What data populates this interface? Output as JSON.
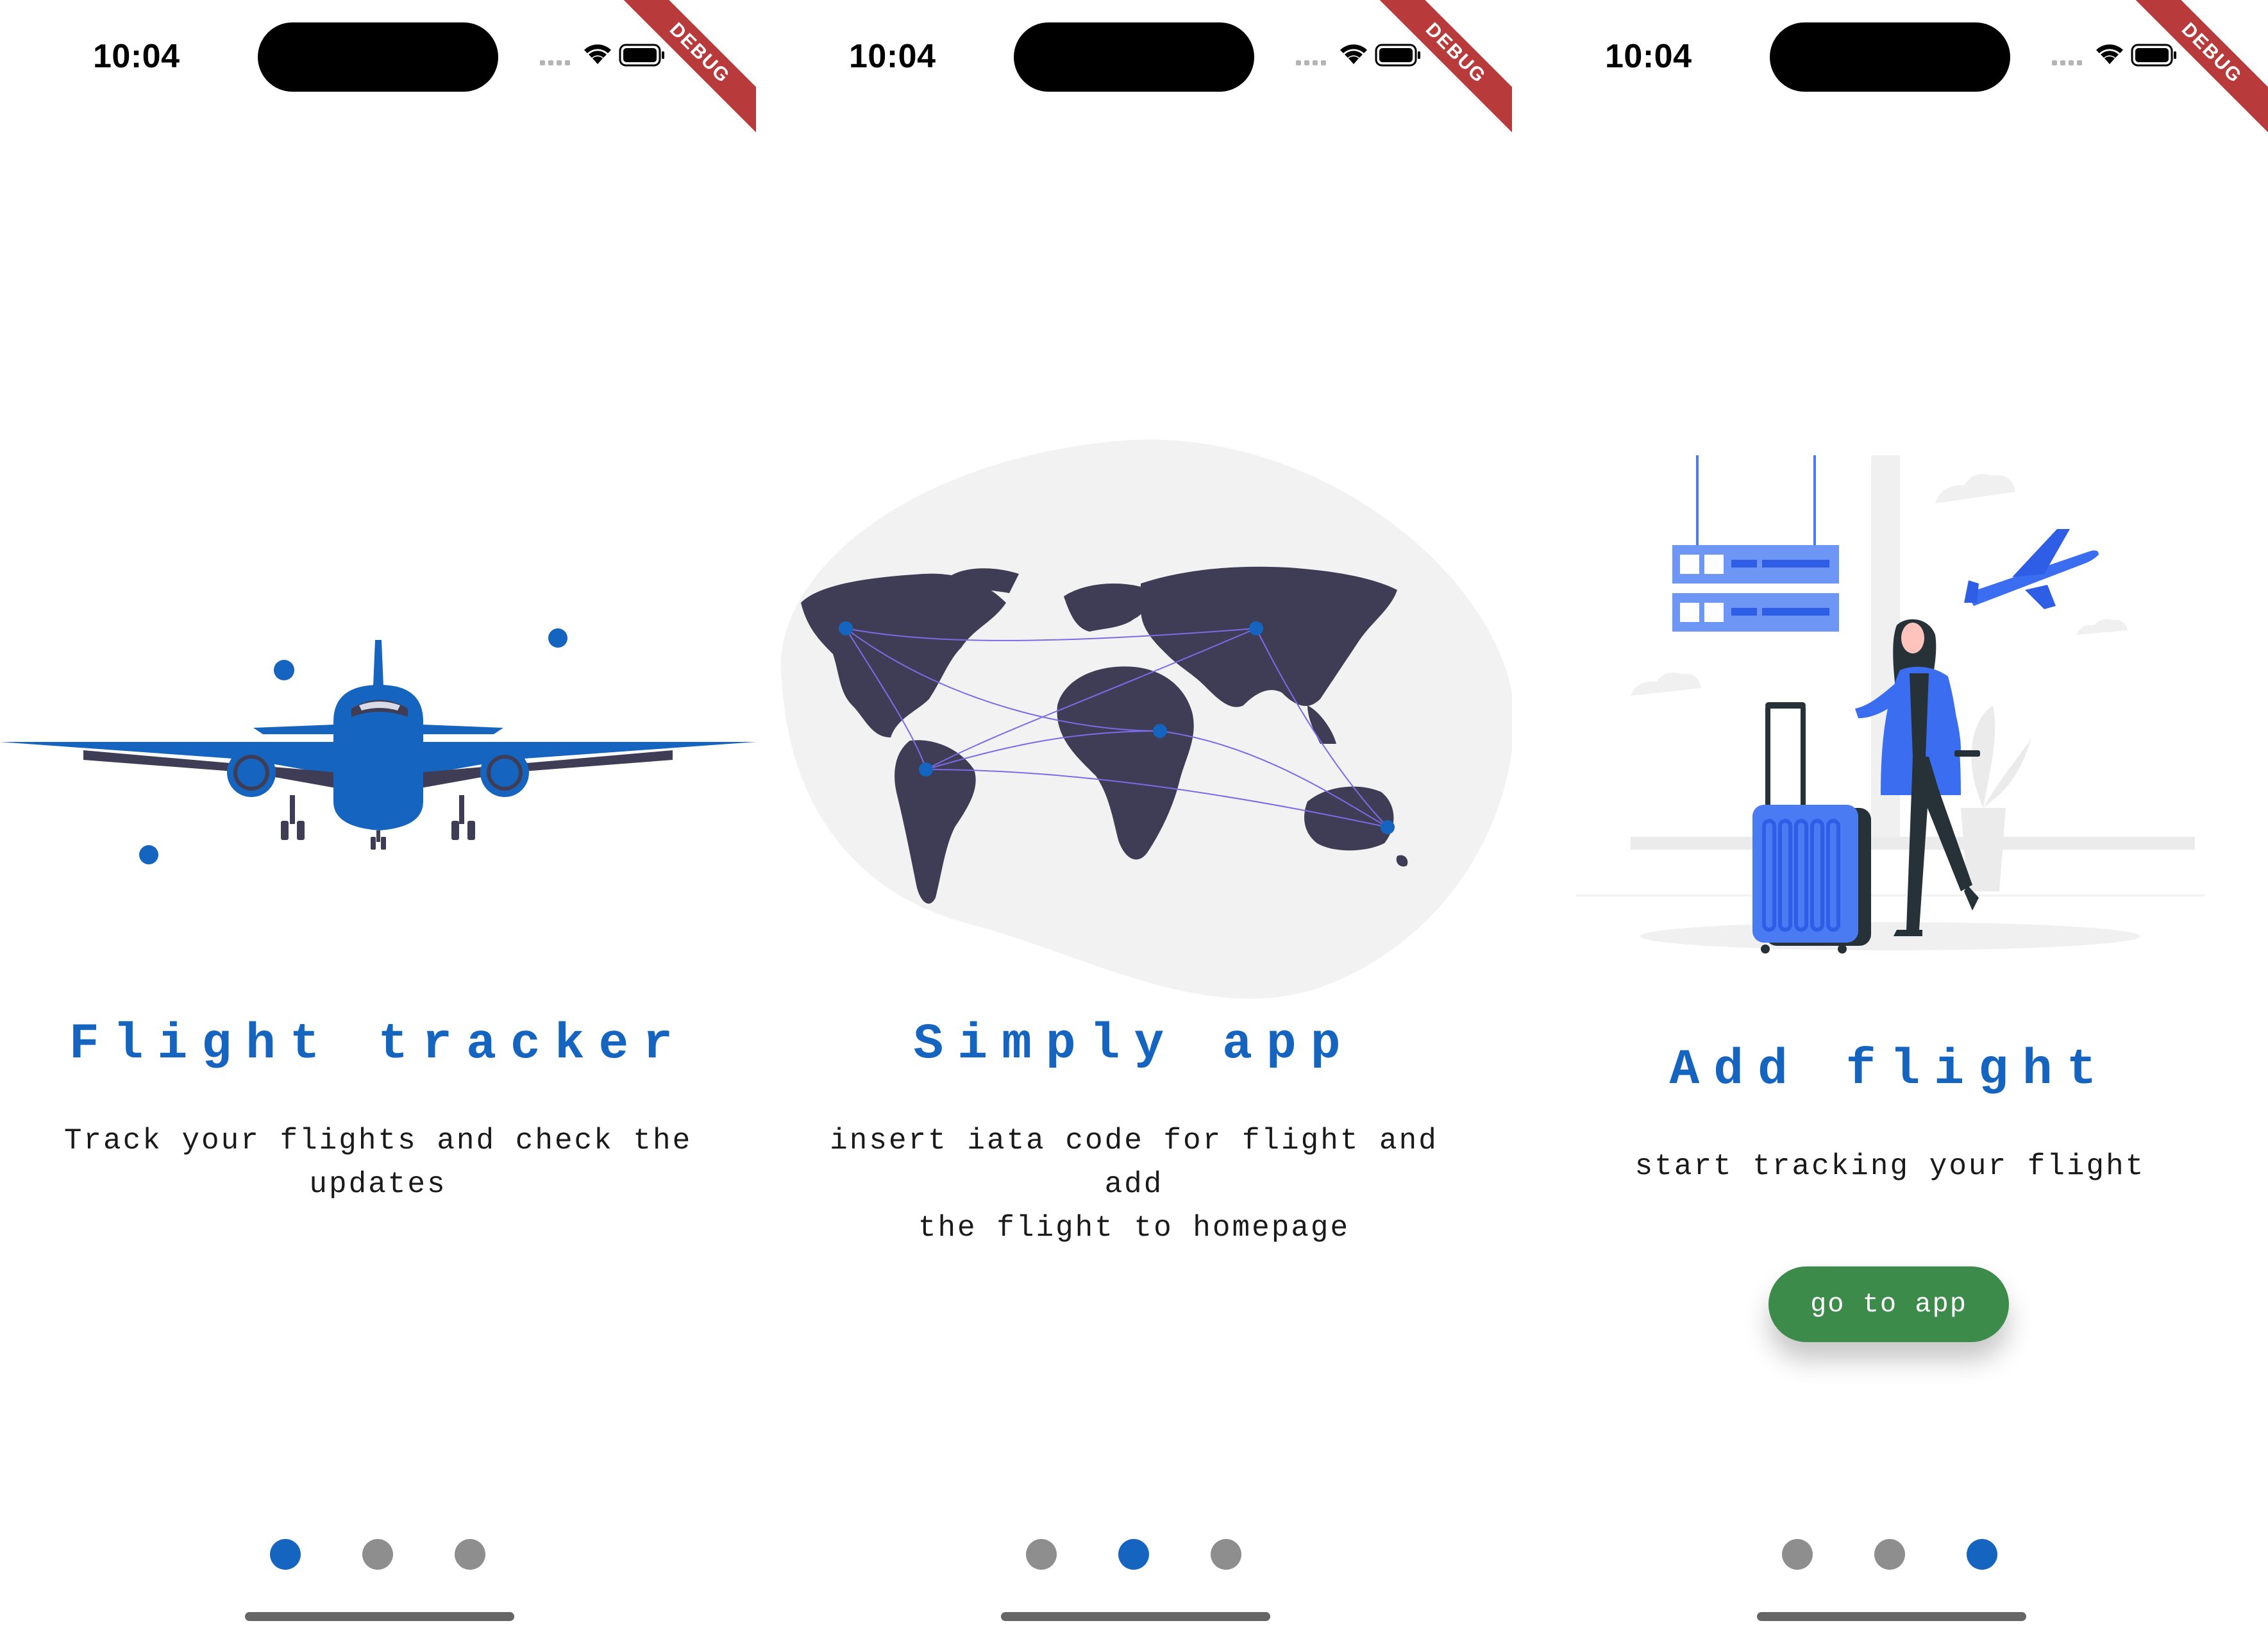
{
  "status_bar": {
    "time": "10:04",
    "debug_label": "DEBUG"
  },
  "pages": [
    {
      "title": "Flight tracker",
      "subtitle_line1": "Track your flights and check the",
      "subtitle_line2": "updates",
      "illustration": "airplane-illustration",
      "active_dot": 0
    },
    {
      "title": "Simply app",
      "subtitle_line1": "insert iata code for flight and add",
      "subtitle_line2": "the flight to homepage",
      "illustration": "world-map-illustration",
      "active_dot": 1
    },
    {
      "title": "Add flight",
      "subtitle_line1": "start tracking your flight",
      "subtitle_line2": "",
      "illustration": "traveler-with-luggage-illustration",
      "active_dot": 2,
      "button_label": "go to app"
    }
  ],
  "colors": {
    "accent": "#1565c0",
    "button": "#3d8b4a",
    "dot_inactive": "#8e8e8e",
    "illustration_dark": "#3f3d56"
  }
}
